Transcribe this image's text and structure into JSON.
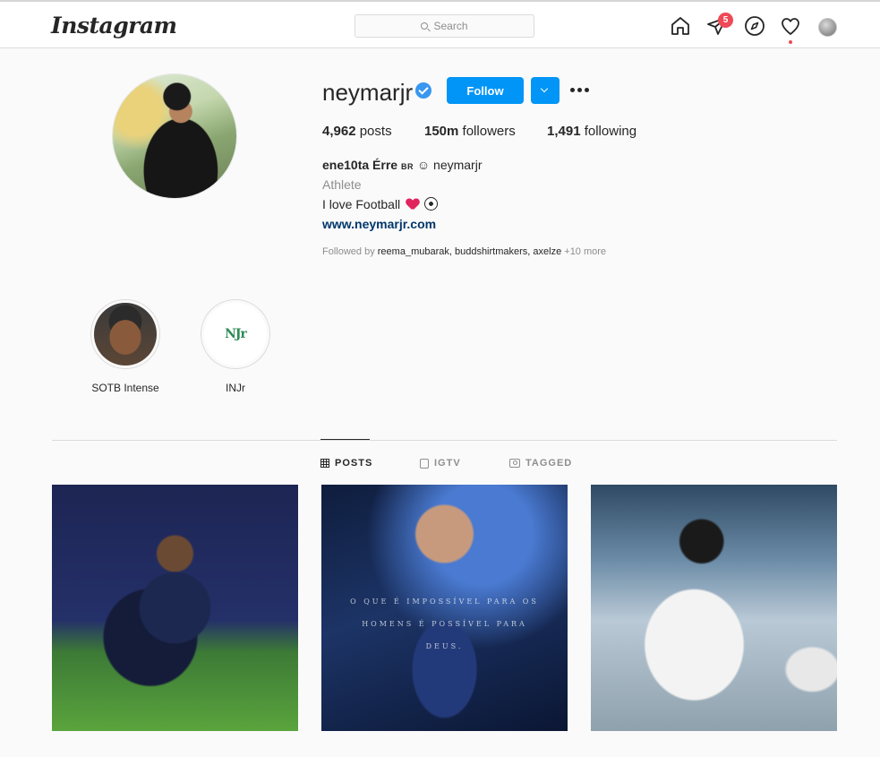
{
  "nav": {
    "logo": "Instagram",
    "search_placeholder": "Search",
    "direct_badge": "5"
  },
  "profile": {
    "username": "neymarjr",
    "follow_label": "Follow",
    "stats": {
      "posts_count": "4,962",
      "posts_label": "posts",
      "followers_count": "150m",
      "followers_label": "followers",
      "following_count": "1,491",
      "following_label": "following"
    },
    "full_name": "ene10ta Érre",
    "country_tag": "BR",
    "handle": "neymarjr",
    "category": "Athlete",
    "bio": "I love Football",
    "website": "www.neymarjr.com",
    "followed_by_prefix": "Followed by",
    "followed_by_users": "reema_mubarak, buddshirtmakers, axelze",
    "followed_by_more": "+10 more"
  },
  "highlights": [
    {
      "label": "SOTB Intense"
    },
    {
      "label": "INJr",
      "logo_text": "NJr"
    }
  ],
  "tabs": [
    {
      "label": "POSTS",
      "active": true
    },
    {
      "label": "IGTV",
      "active": false
    },
    {
      "label": "TAGGED",
      "active": false
    }
  ],
  "posts": [
    {
      "caption": ""
    },
    {
      "caption": "O QUE É IMPOSSÍVEL PARA OS HOMENS É POSSÍVEL PARA DEUS."
    },
    {
      "caption": ""
    }
  ],
  "colors": {
    "accent": "#0095f6",
    "notification": "#ed4956",
    "link": "#00376b",
    "verified": "#3897f0"
  }
}
